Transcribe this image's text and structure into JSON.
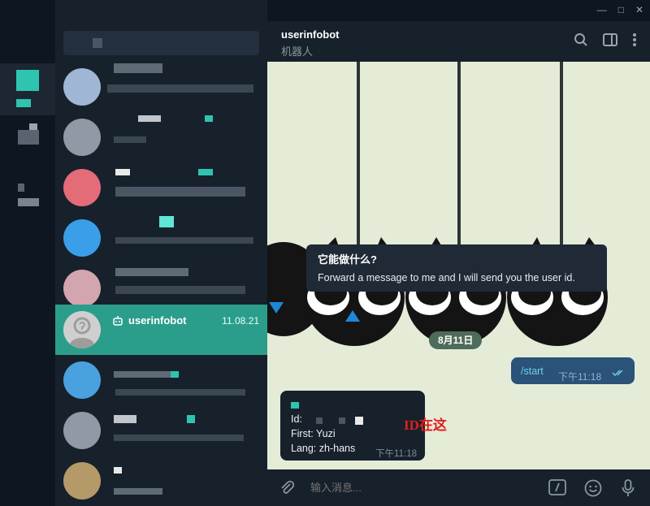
{
  "window": {
    "min_glyph": "—",
    "max_glyph": "□",
    "close_glyph": "✕"
  },
  "chat_list": {
    "active_chat": {
      "title": "userinfobot",
      "date": "11.08.21",
      "bot_icon": "bot-icon"
    }
  },
  "header": {
    "title": "userinfobot",
    "subtitle": "机器人",
    "icons": [
      "search-icon",
      "sidebar-icon",
      "more-icon"
    ]
  },
  "bot_info": {
    "title": "它能做什么?",
    "text": "Forward a message to me and I will send you the user id."
  },
  "date_pill": "8月11日",
  "outgoing": {
    "text": "/start",
    "time": "下午11:18"
  },
  "incoming": {
    "id_label": "Id:",
    "first": "First: Yuzi",
    "lang": "Lang: zh-hans",
    "time": "下午11:18"
  },
  "annotation": "ID在这",
  "composer": {
    "placeholder": "输入消息...",
    "icons": [
      "attach-icon",
      "commands-icon",
      "emoji-icon",
      "mic-icon"
    ]
  },
  "colors": {
    "accent": "#2b9e8b",
    "bg": "#17212b",
    "bubble_out": "#2b5278",
    "wallpaper": "#e4ecd8",
    "annotation": "#e11d1d"
  }
}
